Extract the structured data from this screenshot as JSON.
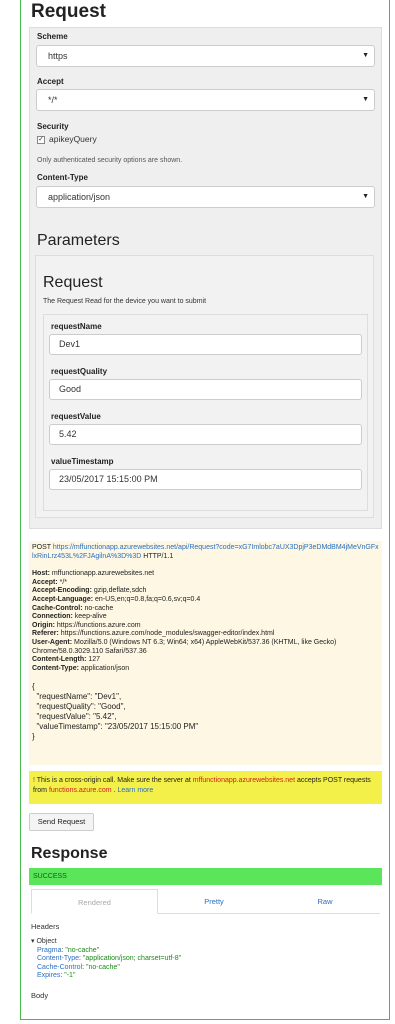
{
  "request": {
    "title": "Request",
    "scheme": {
      "label": "Scheme",
      "value": "https"
    },
    "accept": {
      "label": "Accept",
      "value": "*/*"
    },
    "security": {
      "label": "Security",
      "option": "apikeyQuery",
      "note": "Only authenticated security options are shown."
    },
    "content_type": {
      "label": "Content-Type",
      "value": "application/json"
    }
  },
  "parameters": {
    "title": "Parameters",
    "model": {
      "title": "Request",
      "description": "The Request Read for the device you want to submit",
      "fields": [
        {
          "label": "requestName",
          "value": "Dev1"
        },
        {
          "label": "requestQuality",
          "value": "Good"
        },
        {
          "label": "requestValue",
          "value": "5.42"
        },
        {
          "label": "valueTimestamp",
          "value": "23/05/2017 15:15:00 PM"
        }
      ]
    }
  },
  "raw_request": {
    "method": "POST",
    "url": "https://mffunctionapp.azurewebsites.net/api/Request?code=xG7Imlobc7aUX3DpjP3eDMdBM4jMeVnGFxlxRinLrz453L%2FJAgilnA%3D%3D",
    "protocol": "HTTP/1.1",
    "headers": [
      {
        "name": "Host",
        "value": "mffunctionapp.azurewebsites.net"
      },
      {
        "name": "Accept",
        "value": "*/*"
      },
      {
        "name": "Accept-Encoding",
        "value": "gzip,deflate,sdch"
      },
      {
        "name": "Accept-Language",
        "value": "en-US,en;q=0.8,fa;q=0.6,sv;q=0.4"
      },
      {
        "name": "Cache-Control",
        "value": "no-cache"
      },
      {
        "name": "Connection",
        "value": "keep-alive"
      },
      {
        "name": "Origin",
        "value": "https://functions.azure.com"
      },
      {
        "name": "Referer",
        "value": "https://functions.azure.com/node_modules/swagger-editor/index.html"
      },
      {
        "name": "User-Agent",
        "value": "Mozilla/5.0 (Windows NT 6.3; Win64; x64) AppleWebKit/537.36 (KHTML, like Gecko) Chrome/58.0.3029.110 Safari/537.36"
      },
      {
        "name": "Content-Length",
        "value": "127"
      },
      {
        "name": "Content-Type",
        "value": "application/json"
      }
    ],
    "body_lines": [
      "{",
      "  \"requestName\": \"Dev1\",",
      "  \"requestQuality\": \"Good\",",
      "  \"requestValue\": \"5.42\",",
      "  \"valueTimestamp\": \"23/05/2017 15:15:00 PM\"",
      "}"
    ]
  },
  "warning": {
    "icon": "!",
    "prefix": "This is a cross-origin call. Make sure the server at",
    "server": "mffunctionapp.azurewebsites.net",
    "middle": "accepts POST requests from",
    "origin": "functions.azure.com",
    "sep": ".",
    "learn_more": "Learn more"
  },
  "send_button": "Send Request",
  "response": {
    "title": "Response",
    "status": "SUCCESS",
    "tabs": [
      "Rendered",
      "Pretty",
      "Raw"
    ],
    "headers_label": "Headers",
    "object_label": "Object",
    "header_items": [
      {
        "key": "Pragma",
        "value": "\"no-cache\""
      },
      {
        "key": "Content-Type",
        "value": "\"application/json; charset=utf-8\""
      },
      {
        "key": "Cache-Control",
        "value": "\"no-cache\""
      },
      {
        "key": "Expires",
        "value": "\"-1\""
      }
    ],
    "body_label": "Body"
  }
}
